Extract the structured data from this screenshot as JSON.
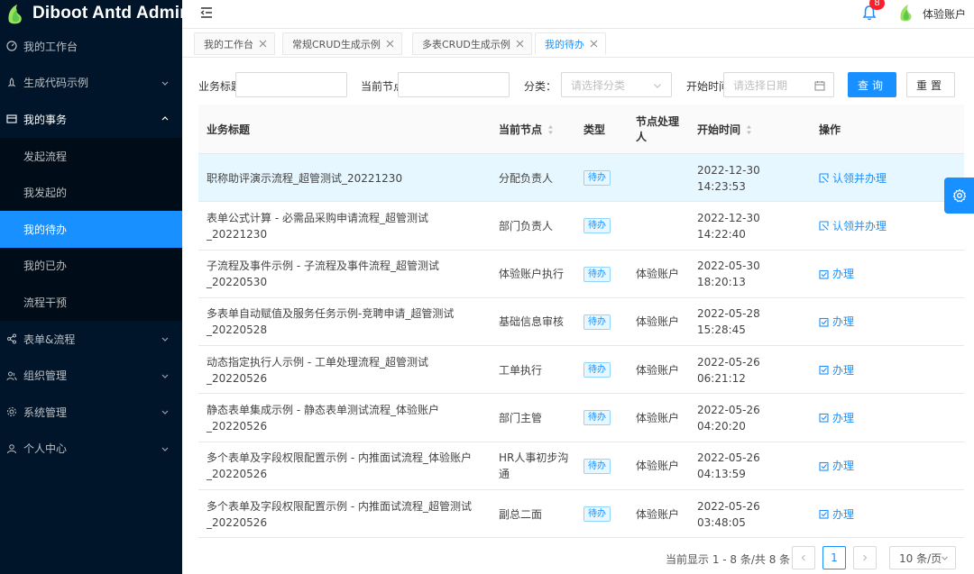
{
  "app": {
    "title": "Diboot Antd Admin"
  },
  "sidebar": {
    "items": [
      {
        "label": "我的工作台",
        "icon": "dashboard-icon"
      },
      {
        "label": "生成代码示例",
        "icon": "rocket-icon"
      },
      {
        "label": "我的事务",
        "icon": "form-icon",
        "open": true,
        "children": [
          {
            "label": "发起流程"
          },
          {
            "label": "我发起的"
          },
          {
            "label": "我的待办",
            "active": true
          },
          {
            "label": "我的已办"
          },
          {
            "label": "流程干预"
          }
        ]
      },
      {
        "label": "表单&流程",
        "icon": "share-icon"
      },
      {
        "label": "组织管理",
        "icon": "team-icon"
      },
      {
        "label": "系统管理",
        "icon": "setting-icon"
      },
      {
        "label": "个人中心",
        "icon": "user-icon"
      }
    ]
  },
  "header": {
    "notification_count": "8",
    "user_name": "体验账户"
  },
  "tabs": [
    {
      "label": "我的工作台"
    },
    {
      "label": "常规CRUD生成示例"
    },
    {
      "label": "多表CRUD生成示例"
    },
    {
      "label": "我的待办",
      "active": true
    }
  ],
  "search": {
    "title_label": "业务标题",
    "node_label": "当前节点",
    "category_label": "分类：",
    "category_placeholder": "请选择分类",
    "start_label": "开始时间",
    "date_placeholder": "请选择日期",
    "query_button": "查询",
    "reset_button": "重置"
  },
  "table": {
    "columns": [
      "业务标题",
      "当前节点",
      "类型",
      "节点处理人",
      "开始时间",
      "操作"
    ],
    "rows": [
      {
        "title": "职称助评演示流程_超管测试_20221230",
        "node": "分配负责人",
        "type": "待办",
        "handler": "",
        "date": "2022-12-30",
        "time": "14:23:53",
        "action": "认领并办理",
        "highlight": true
      },
      {
        "title": "表单公式计算 - 必需品采购申请流程_超管测试_20221230",
        "node": "部门负责人",
        "type": "待办",
        "handler": "",
        "date": "2022-12-30",
        "time": "14:22:40",
        "action": "认领并办理"
      },
      {
        "title": "子流程及事件示例 - 子流程及事件流程_超管测试_20220530",
        "node": "体验账户执行",
        "type": "待办",
        "handler": "体验账户",
        "date": "2022-05-30",
        "time": "18:20:13",
        "action": "办理"
      },
      {
        "title": "多表单自动赋值及服务任务示例-竞聘申请_超管测试_20220528",
        "node": "基础信息审核",
        "type": "待办",
        "handler": "体验账户",
        "date": "2022-05-28",
        "time": "15:28:45",
        "action": "办理"
      },
      {
        "title": "动态指定执行人示例 - 工单处理流程_超管测试_20220526",
        "node": "工单执行",
        "type": "待办",
        "handler": "体验账户",
        "date": "2022-05-26",
        "time": "06:21:12",
        "action": "办理"
      },
      {
        "title": "静态表单集成示例 - 静态表单测试流程_体验账户_20220526",
        "node": "部门主管",
        "type": "待办",
        "handler": "体验账户",
        "date": "2022-05-26",
        "time": "04:20:20",
        "action": "办理"
      },
      {
        "title": "多个表单及字段权限配置示例 - 内推面试流程_体验账户_20220526",
        "node": "HR人事初步沟通",
        "type": "待办",
        "handler": "体验账户",
        "date": "2022-05-26",
        "time": "04:13:59",
        "action": "办理"
      },
      {
        "title": "多个表单及字段权限配置示例 - 内推面试流程_超管测试_20220526",
        "node": "副总二面",
        "type": "待办",
        "handler": "体验账户",
        "date": "2022-05-26",
        "time": "03:48:05",
        "action": "办理"
      }
    ]
  },
  "pagination": {
    "total_text": "当前显示 1 - 8 条/共 8 条",
    "current_page": "1",
    "page_size": "10 条/页"
  },
  "colors": {
    "accent": "#1890ff",
    "sidebar": "#001529",
    "badge": "#f5222d"
  }
}
